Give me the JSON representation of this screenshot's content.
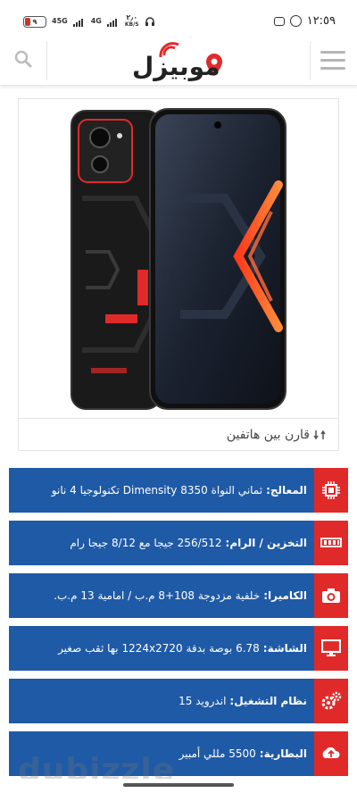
{
  "status_bar": {
    "battery": "٩",
    "network_a": "45G",
    "network_b": "4G",
    "speed_value": "٢٫٠",
    "speed_unit": "KB/S",
    "time": "١٢:٥٩"
  },
  "header": {
    "logo_text": "موبيزل"
  },
  "product": {
    "compare_label": "قارن بين هاتفين"
  },
  "specs": [
    {
      "icon": "processor-icon",
      "label": "المعالج:",
      "value": "ثماني النواة Dimensity 8350 تكنولوجيا 4 نانو"
    },
    {
      "icon": "memory-icon",
      "label": "التخزين / الرام:",
      "value": "256/512 جيجا مع 8/12 جيجا رام"
    },
    {
      "icon": "camera-icon",
      "label": "الكاميرا:",
      "value": "خلفية مزدوجة 108+8 م.ب / امامية 13 م.ب."
    },
    {
      "icon": "monitor-icon",
      "label": "الشاشة:",
      "value": "6.78 بوصة بدقة 1224x2720 بها ثقب صغير"
    },
    {
      "icon": "gears-icon",
      "label": "نظام التشغيل:",
      "value": "اندرويد 15"
    },
    {
      "icon": "battery-upload-icon",
      "label": "البطارية:",
      "value": "5500 مللي أمبير"
    }
  ],
  "watermark": "dubizzle",
  "colors": {
    "spec_bg": "#1f5aa6",
    "spec_icon_bg": "#e02a2a",
    "accent_red": "#e02a2a"
  }
}
